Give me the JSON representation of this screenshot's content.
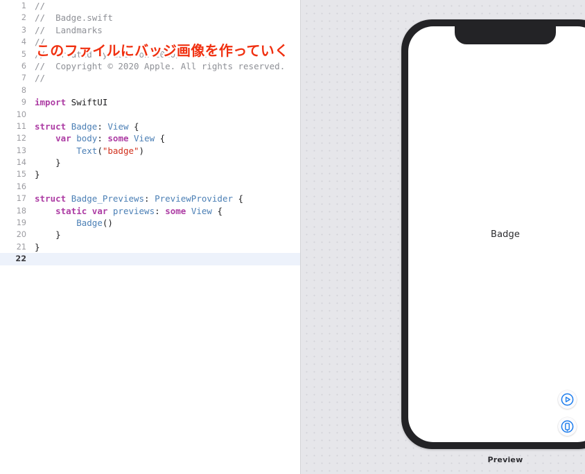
{
  "editor": {
    "current_line": 22,
    "annotation": {
      "text": "このファイルにバッジ画像を作っていく",
      "color": "#f03010",
      "outline_color": "#ffffff",
      "over_line": 5
    },
    "colors": {
      "background": "#ffffff",
      "gutter_text": "#9b9ba0",
      "current_line_highlight": "#edf2fb",
      "comment": "#8e9096",
      "keyword": "#ad3da4",
      "type": "#4b7fb5",
      "string": "#d12f1b",
      "plain": "#1c1c1e"
    },
    "lines": [
      {
        "n": 1,
        "tokens": [
          {
            "t": "cmt",
            "s": "//"
          }
        ]
      },
      {
        "n": 2,
        "tokens": [
          {
            "t": "cmt",
            "s": "//  Badge.swift"
          }
        ]
      },
      {
        "n": 3,
        "tokens": [
          {
            "t": "cmt",
            "s": "//  Landmarks"
          }
        ]
      },
      {
        "n": 4,
        "tokens": [
          {
            "t": "cmt",
            "s": "//"
          }
        ]
      },
      {
        "n": 5,
        "tokens": [
          {
            "t": "cmt",
            "s": "//  Created by user on 2020/xx/xx."
          }
        ]
      },
      {
        "n": 6,
        "tokens": [
          {
            "t": "cmt",
            "s": "//  Copyright © 2020 Apple. All rights reserved."
          }
        ]
      },
      {
        "n": 7,
        "tokens": [
          {
            "t": "cmt",
            "s": "//"
          }
        ]
      },
      {
        "n": 8,
        "tokens": []
      },
      {
        "n": 9,
        "tokens": [
          {
            "t": "kw",
            "s": "import"
          },
          {
            "t": "plain",
            "s": " SwiftUI"
          }
        ]
      },
      {
        "n": 10,
        "tokens": []
      },
      {
        "n": 11,
        "tokens": [
          {
            "t": "kw",
            "s": "struct"
          },
          {
            "t": "plain",
            "s": " "
          },
          {
            "t": "type",
            "s": "Badge"
          },
          {
            "t": "plain",
            "s": ": "
          },
          {
            "t": "type",
            "s": "View"
          },
          {
            "t": "plain",
            "s": " {"
          }
        ]
      },
      {
        "n": 12,
        "tokens": [
          {
            "t": "plain",
            "s": "    "
          },
          {
            "t": "kw",
            "s": "var"
          },
          {
            "t": "plain",
            "s": " "
          },
          {
            "t": "type",
            "s": "body"
          },
          {
            "t": "plain",
            "s": ": "
          },
          {
            "t": "kw",
            "s": "some"
          },
          {
            "t": "plain",
            "s": " "
          },
          {
            "t": "type",
            "s": "View"
          },
          {
            "t": "plain",
            "s": " {"
          }
        ]
      },
      {
        "n": 13,
        "tokens": [
          {
            "t": "plain",
            "s": "        "
          },
          {
            "t": "type",
            "s": "Text"
          },
          {
            "t": "plain",
            "s": "("
          },
          {
            "t": "str",
            "s": "\"badge\""
          },
          {
            "t": "plain",
            "s": ")"
          }
        ]
      },
      {
        "n": 14,
        "tokens": [
          {
            "t": "plain",
            "s": "    }"
          }
        ]
      },
      {
        "n": 15,
        "tokens": [
          {
            "t": "plain",
            "s": "}"
          }
        ]
      },
      {
        "n": 16,
        "tokens": []
      },
      {
        "n": 17,
        "tokens": [
          {
            "t": "kw",
            "s": "struct"
          },
          {
            "t": "plain",
            "s": " "
          },
          {
            "t": "type",
            "s": "Badge_Previews"
          },
          {
            "t": "plain",
            "s": ": "
          },
          {
            "t": "type",
            "s": "PreviewProvider"
          },
          {
            "t": "plain",
            "s": " {"
          }
        ]
      },
      {
        "n": 18,
        "tokens": [
          {
            "t": "plain",
            "s": "    "
          },
          {
            "t": "kw",
            "s": "static"
          },
          {
            "t": "plain",
            "s": " "
          },
          {
            "t": "kw",
            "s": "var"
          },
          {
            "t": "plain",
            "s": " "
          },
          {
            "t": "type",
            "s": "previews"
          },
          {
            "t": "plain",
            "s": ": "
          },
          {
            "t": "kw",
            "s": "some"
          },
          {
            "t": "plain",
            "s": " "
          },
          {
            "t": "type",
            "s": "View"
          },
          {
            "t": "plain",
            "s": " {"
          }
        ]
      },
      {
        "n": 19,
        "tokens": [
          {
            "t": "plain",
            "s": "        "
          },
          {
            "t": "type",
            "s": "Badge"
          },
          {
            "t": "plain",
            "s": "()"
          }
        ]
      },
      {
        "n": 20,
        "tokens": [
          {
            "t": "plain",
            "s": "    }"
          }
        ]
      },
      {
        "n": 21,
        "tokens": [
          {
            "t": "plain",
            "s": "}"
          }
        ]
      },
      {
        "n": 22,
        "tokens": []
      }
    ]
  },
  "canvas": {
    "background_color": "#e6e6ea",
    "device": {
      "frame_color": "#232326",
      "screen_color": "#ffffff",
      "has_notch": true
    },
    "preview": {
      "screen_text": "Badge",
      "caption": "Preview"
    },
    "controls": [
      {
        "name": "live-preview-play-button",
        "icon": "play-circle-icon",
        "color": "#1a7ced"
      },
      {
        "name": "preview-on-device-button",
        "icon": "device-circle-icon",
        "color": "#1a7ced"
      }
    ]
  }
}
